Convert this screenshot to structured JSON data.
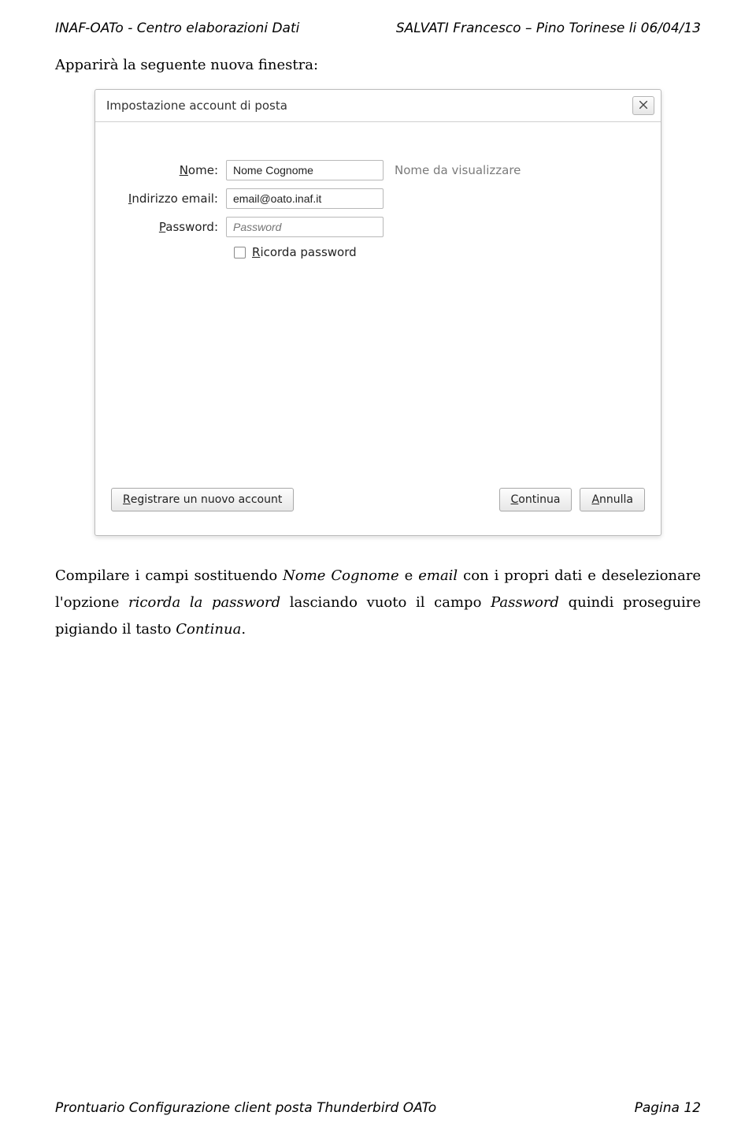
{
  "header": {
    "left": "INAF-OATo - Centro elaborazioni Dati",
    "right": "SALVATI Francesco – Pino Torinese li 06/04/13"
  },
  "intro": "Apparirà la seguente nuova finestra:",
  "dialog": {
    "title": "Impostazione account di posta",
    "name": {
      "label_prefix": "N",
      "label_rest": "ome:",
      "value": "Nome Cognome",
      "hint": "Nome da visualizzare"
    },
    "email": {
      "label_prefix": "I",
      "label_rest": "ndirizzo email:",
      "value": "email@oato.inaf.it"
    },
    "password": {
      "label_prefix": "P",
      "label_rest": "assword:",
      "placeholder": "Password"
    },
    "remember": {
      "label_prefix": "R",
      "label_rest": "icorda password"
    },
    "buttons": {
      "register_prefix": "R",
      "register_rest": "egistrare un nuovo account",
      "continue_prefix": "C",
      "continue_rest": "ontinua",
      "cancel_prefix": "A",
      "cancel_rest": "nnulla"
    }
  },
  "instructions": {
    "t1": "Compilare i campi sostituendo ",
    "i1": "Nome Cognome",
    "t2": " e ",
    "i2": "email",
    "t3": " con i propri dati e deselezionare l'opzione ",
    "i3": "ricorda la password",
    "t4": " lasciando vuoto il campo ",
    "i4": "Password",
    "t5": " quindi proseguire pigiando il tasto ",
    "i5": "Continua",
    "t6": "."
  },
  "footer": {
    "left": "Prontuario Configurazione client posta Thunderbird OATo",
    "right": "Pagina 12"
  }
}
